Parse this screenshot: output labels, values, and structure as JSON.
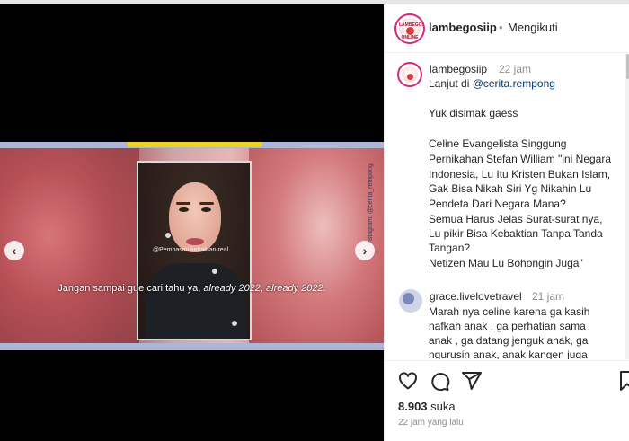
{
  "video": {
    "subtitle_normal": "Jangan sampai gue cari tahu ya, ",
    "subtitle_italic1": "already 2022",
    "subtitle_sep": ", ",
    "subtitle_italic2": "already 2022",
    "subtitle_end": ".",
    "watermark": "@Pembasmi.kehaluan.real",
    "side_watermark": "Instagram: @cerita_rempong",
    "prev_icon": "chevron-left-icon",
    "next_icon": "chevron-right-icon"
  },
  "header": {
    "username": "lambegosiip",
    "separator": "•",
    "follow_label": "Mengikuti",
    "logo_text_top": "LAMBEGOSIIP",
    "logo_text_bottom": "ONLINE"
  },
  "caption": {
    "username": "lambegosiip",
    "time": "22 jam",
    "lines": [
      {
        "pre": "Lanjut di ",
        "mention": "@cerita.rempong"
      },
      "Yuk disimak gaess",
      "Celine Evangelista Singgung",
      "Pernikahan Stefan William \"ini Negara",
      "Indonesia, Lu Itu Kristen Bukan Islam,",
      "Gak Bisa Nikah Siri Yg Nikahin Lu",
      "Pendeta Dari Negara Mana?",
      "Semua Harus Jelas Surat-surat nya,",
      "Lu pikir Bisa Kebaktian Tanpa Tanda",
      "Tangan?",
      "Netizen Mau Lu Bohongin Juga\""
    ]
  },
  "comment": {
    "username": "grace.livelovetravel",
    "time": "21 jam",
    "lines": [
      "Marah nya celine karena ga kasih",
      "nafkah anak , ga perhatian sama",
      "anak , ga datang jenguk anak, ga",
      "ngurusin anak, anak kangen juga"
    ]
  },
  "actions": {
    "like_icon": "heart-icon",
    "comment_icon": "comment-icon",
    "share_icon": "share-icon",
    "save_icon": "bookmark-icon",
    "likes_count": "8.903",
    "likes_label": "suka",
    "posted": "22 jam yang lalu"
  },
  "colors": {
    "accent": "#d62976",
    "mention": "#00376b",
    "muted": "#8e8e8e"
  }
}
